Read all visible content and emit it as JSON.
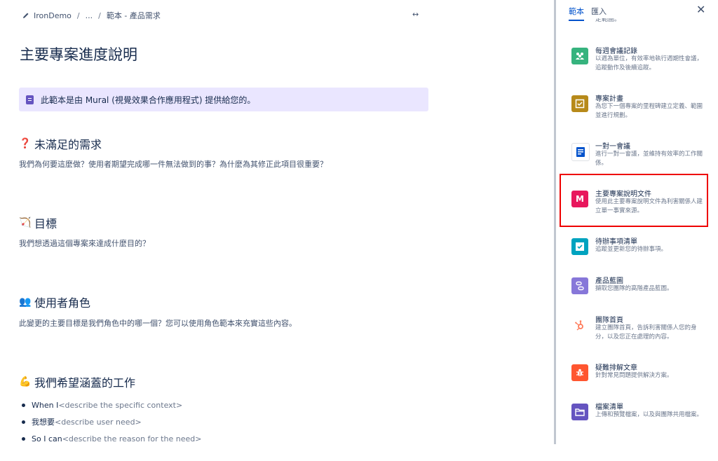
{
  "breadcrumb": {
    "space": "IronDemo",
    "ellipsis": "...",
    "current": "範本 - 產品需求"
  },
  "expand_icon": "↔",
  "page": {
    "title": "主要專案進度說明",
    "info_text": "此範本是由 Mural (視覺效果合作應用程式) 提供給您的。",
    "sections": [
      {
        "emoji": "❓",
        "heading": "未滿足的需求",
        "text": "我們為何要這麼做？使用者期望完成哪一件無法做到的事？為什麼為其修正此項目很重要？"
      },
      {
        "emoji": "🏹",
        "heading": "目標",
        "text": "我們想透過這個專案來達成什麼目的？"
      },
      {
        "emoji": "👥",
        "heading": "使用者角色",
        "text": "此變更的主要目標是我們角色中的哪一個？您可以使用角色範本來充實這些內容。"
      },
      {
        "emoji": "💪",
        "heading": "我們希望涵蓋的工作",
        "text": ""
      }
    ],
    "bullets": [
      {
        "lead": "When I",
        "placeholder": "<describe the specific context>"
      },
      {
        "lead": "我想要",
        "placeholder": "<describe user need>"
      },
      {
        "lead": "So I can",
        "placeholder": "<describe the reason for the need>"
      }
    ]
  },
  "panel": {
    "tabs": [
      {
        "label": "範本",
        "active": true
      },
      {
        "label": "匯入",
        "active": false
      }
    ],
    "clipped_text": "定範圍。",
    "items": [
      {
        "name": "每週會議記錄",
        "desc": "以週為單位，有效率地執行週期性會議，追蹤動作及後續追蹤。",
        "icon": "people-icon",
        "color": "#36b37e"
      },
      {
        "name": "專案計畫",
        "desc": "為您下一個專案的里程碑建立定義、範圍並進行規劃。",
        "icon": "checkbox-icon",
        "color": "#b78a1a"
      },
      {
        "name": "一對一會議",
        "desc": "進行一對一會議，並維持有效率的工作關係。",
        "icon": "document-icon",
        "color": "#ffffff"
      },
      {
        "name": "主要專案說明文件",
        "desc": "使用此主要專案說明文件為利害關係人建立單一事實來源。",
        "icon": "mural-icon",
        "color": "#e8175d"
      },
      {
        "name": "待辦事項清單",
        "desc": "追蹤並更新您的待辦事項。",
        "icon": "checklist-icon",
        "color": "#00a3bf"
      },
      {
        "name": "產品藍圖",
        "desc": "擷取您團隊的高階產品藍圖。",
        "icon": "roadmap-icon",
        "color": "#8777d9"
      },
      {
        "name": "團隊首頁",
        "desc": "建立團隊首頁，告訴利害關係人您的身分，以及您正在處理的內容。",
        "icon": "hubspot-icon",
        "color": "#ffffff"
      },
      {
        "name": "疑難排解文章",
        "desc": "針對常見問題提供解決方案。",
        "icon": "bug-icon",
        "color": "#ff5630"
      },
      {
        "name": "檔案清單",
        "desc": "上傳和預覽檔案，以及與團隊共用檔案。",
        "icon": "folder-icon",
        "color": "#6554c0"
      }
    ]
  }
}
